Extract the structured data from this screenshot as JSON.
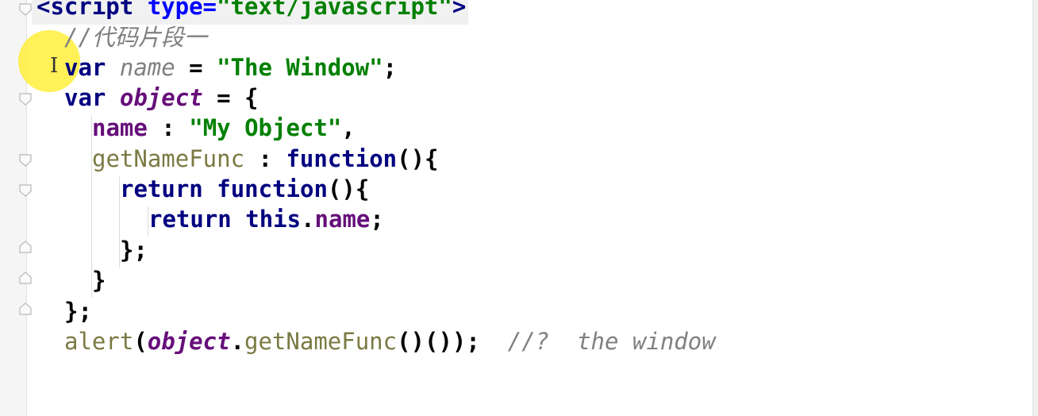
{
  "editor": {
    "lines": [
      {
        "open": "<",
        "tag": "script",
        "space": " ",
        "attr": "type",
        "eq": "=",
        "value": "\"text/javascript\"",
        "close": ">"
      },
      {
        "comment": "//代码片段一"
      },
      {
        "kw": "var",
        "name": "name",
        "eq": " = ",
        "str": "\"The Window\"",
        "semi": ";"
      },
      {
        "kw": "var",
        "name": "object",
        "rest": " = {"
      },
      {
        "prop": "name",
        "sep": " : ",
        "str": "\"My Object\"",
        "comma": ","
      },
      {
        "fn": "getNameFunc",
        "sep": " : ",
        "kw": "function",
        "rest": "(){"
      },
      {
        "kw1": "return",
        "kw2": "function",
        "rest": "(){"
      },
      {
        "kw1": "return",
        "kw2": "this",
        "dot": ".",
        "prop": "name",
        "semi": ";"
      },
      {
        "text": "};"
      },
      {
        "text": "}"
      },
      {
        "text": "};"
      },
      {
        "fn": "alert",
        "open": "(",
        "obj": "object",
        "dot": ".",
        "method": "getNameFunc",
        "rest": "()());",
        "comment": "//?  the window"
      }
    ]
  },
  "colors": {
    "keyword": "#000080",
    "string": "#008000",
    "comment": "#808080",
    "property": "#660e7a",
    "function": "#7a7a43",
    "highlight": "#ffee32"
  },
  "icons": {
    "fold": "fold-marker-icon",
    "cursor": "text-cursor-icon"
  }
}
